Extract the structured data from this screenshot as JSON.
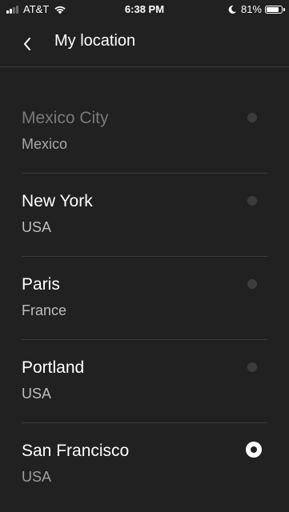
{
  "status_bar": {
    "carrier": "AT&T",
    "time": "6:38 PM",
    "battery": "81%",
    "battery_level": 0.81
  },
  "header": {
    "title": "My location"
  },
  "locations": [
    {
      "city": "Mexico City",
      "country": "Mexico",
      "selected": false
    },
    {
      "city": "New York",
      "country": "USA",
      "selected": false
    },
    {
      "city": "Paris",
      "country": "France",
      "selected": false
    },
    {
      "city": "Portland",
      "country": "USA",
      "selected": false
    },
    {
      "city": "San Francisco",
      "country": "USA",
      "selected": true
    }
  ],
  "colors": {
    "background": "#212121",
    "divider": "#3a3a3a",
    "text_primary": "#ffffff",
    "text_secondary": "#bdbdbd"
  }
}
